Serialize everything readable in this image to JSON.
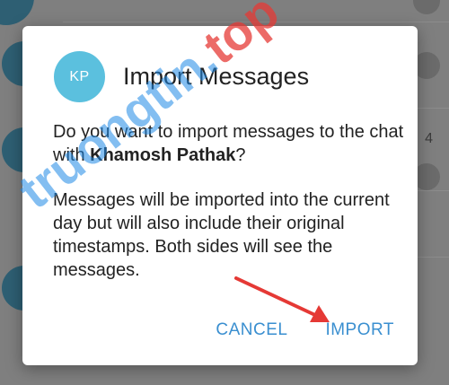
{
  "background": {
    "list_time_partial": "4"
  },
  "dialog": {
    "avatar_initials": "KP",
    "title": "Import Messages",
    "question_prefix": "Do you want to import messages to the chat with ",
    "contact_name": "Khamosh Pathak",
    "question_suffix": "?",
    "description": "Messages will be imported into the current day but will also include their original timestamps. Both sides will see the messages.",
    "cancel_label": "CANCEL",
    "import_label": "IMPORT"
  },
  "watermark": {
    "text": "truongtin.top"
  },
  "colors": {
    "accent": "#3a8fd0",
    "avatar": "#5bc0de",
    "annotation_arrow": "#e53935",
    "watermark": "#1e88e5"
  }
}
